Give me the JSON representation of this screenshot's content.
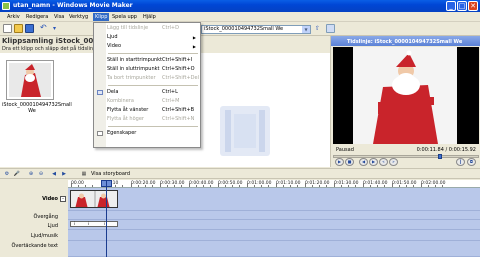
{
  "window": {
    "title": "utan_namn - Windows Movie Maker",
    "minimize_glyph": "_",
    "maximize_glyph": "□",
    "close_glyph": "✕"
  },
  "menubar": {
    "items": [
      "Arkiv",
      "Redigera",
      "Visa",
      "Verktyg",
      "Klipp",
      "Spela upp",
      "Hjälp"
    ],
    "active": "Klipp"
  },
  "toolbar": {
    "collection_combo": "iStock_000010494732Small We"
  },
  "collection": {
    "title": "Klippsamling iStock_000010",
    "subtitle": "Dra ett klipp och släpp det på tidslinjen ne",
    "clip_label": "iStock_000010494732Small We"
  },
  "clip_menu": {
    "items": [
      {
        "label": "Lägg till tidslinje",
        "shortcut": "Ctrl+D",
        "disabled": true
      },
      {
        "label": "Ljud",
        "shortcut": "",
        "submenu": true,
        "disabled": false
      },
      {
        "label": "Video",
        "shortcut": "",
        "submenu": true,
        "disabled": false
      },
      {
        "sep": true
      },
      {
        "label": "Ställ in starttrimpunkt",
        "shortcut": "Ctrl+Shift+I",
        "disabled": false
      },
      {
        "label": "Ställ in sluttrimpunkt",
        "shortcut": "Ctrl+Shift+O",
        "disabled": false
      },
      {
        "label": "Ta bort trimpunkter",
        "shortcut": "Ctrl+Shift+Del",
        "disabled": true
      },
      {
        "sep": true
      },
      {
        "label": "Dela",
        "shortcut": "Ctrl+L",
        "disabled": false
      },
      {
        "label": "Kombinera",
        "shortcut": "Ctrl+M",
        "disabled": true
      },
      {
        "label": "Flytta åt vänster",
        "shortcut": "Ctrl+Shift+B",
        "disabled": false
      },
      {
        "label": "Flytta åt höger",
        "shortcut": "Ctrl+Shift+N",
        "disabled": true
      },
      {
        "sep": true
      },
      {
        "label": "Egenskaper",
        "shortcut": "",
        "disabled": false
      }
    ]
  },
  "monitor": {
    "title": "Tidslinje: iStock_000010494732Small We",
    "state": "Pausad",
    "time": "0:00:11.84 / 0:00:15.92",
    "seek_fraction": 0.74
  },
  "storyboard": {
    "show_storyboard_label": "Visa storyboard"
  },
  "timeline": {
    "ruler_labels": [
      "00.00",
      "0:00:10",
      "0:00:20.00",
      "0:00:30.00",
      "0:00:40.00",
      "0:00:50.00",
      "0:01:00.00",
      "0:01:10.00",
      "0:01:20.00",
      "0:01:30.00",
      "0:01:40.00",
      "0:01:50.00",
      "0:02:00.00"
    ],
    "tracks": [
      "Video",
      "Övergång",
      "Ljud",
      "Ljud/musik",
      "Övertäckande text"
    ],
    "audio_markers": [
      "i",
      "i",
      "i"
    ],
    "expander_glyph": "-"
  },
  "colors": {
    "menu_highlight": "#316ac5",
    "titlebar": "#0046d5",
    "timeline_bg": "#c4d2ef"
  }
}
